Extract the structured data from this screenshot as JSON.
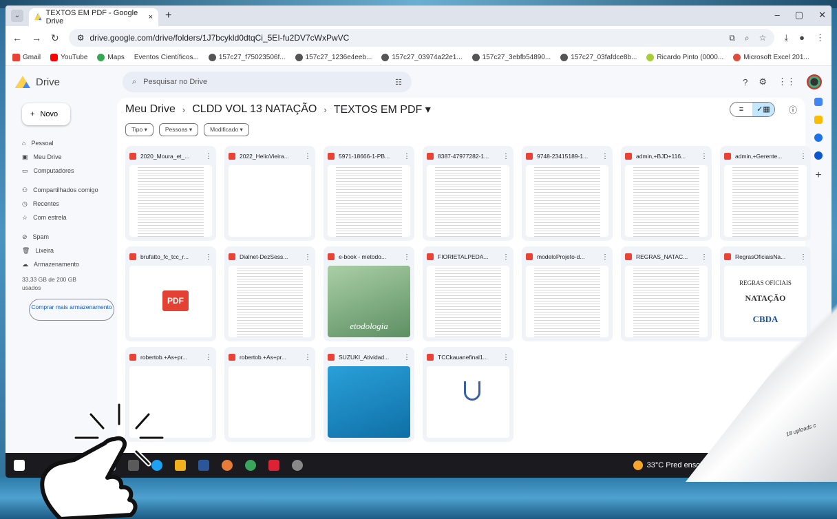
{
  "browser": {
    "tab_title": "TEXTOS EM PDF - Google Drive",
    "tab_close": "×",
    "new_tab": "+",
    "url": "drive.google.com/drive/folders/1J7bcykld0dtqCi_5EI-fu2DV7cWxPwVC",
    "bookmarks": [
      "Gmail",
      "YouTube",
      "Maps",
      "Eventos Científicos...",
      "157c27_f75023506f...",
      "157c27_1236e4eeb...",
      "157c27_03974a22e1...",
      "157c27_3ebfb54890...",
      "157c27_03fafdce8b...",
      "Ricardo Pinto (0000...",
      "Microsoft Excel 201..."
    ]
  },
  "drive": {
    "logo": "Drive",
    "search_placeholder": "Pesquisar no Drive",
    "new_label": "Novo",
    "nav": [
      "Pessoal",
      "Meu Drive",
      "Computadores",
      "Compartilhados comigo",
      "Recentes",
      "Com estrela",
      "Spam",
      "Lixeira",
      "Armazenamento"
    ],
    "storage": "33,33 GB de 200 GB usados",
    "buy_label": "Comprar mais armazenamento",
    "breadcrumb": [
      "Meu Drive",
      "CLDD VOL 13 NATAÇÃO",
      "TEXTOS EM PDF ▾"
    ],
    "filters": [
      "Tipo ▾",
      "Pessoas ▾",
      "Modificado ▾"
    ],
    "files": [
      "2020_Moura_et_...",
      "2022_HelioVieira...",
      "5971-18666-1-PB...",
      "8387-47977282-1...",
      "9748-23415189-1...",
      "admin,+BJD+116...",
      "admin,+Gerente...",
      "brufatto_fc_tcc_r...",
      "Dialnet-DezSess...",
      "e-book - metodo...",
      "FIORIETALPEDA...",
      "modeloProjeto-d...",
      "REGRAS_NATAC...",
      "RegrasOficiaisNa...",
      "robertob.+As+pr...",
      "robertob.+As+pr...",
      "SUZUKI_Atividad...",
      "TCCkauanefinal1..."
    ],
    "thumb_pdf_label": "PDF",
    "thumb_metodo_text": "etodologia",
    "thumb_regras_line1": "REGRAS OFICIAIS",
    "thumb_regras_line2": "NATAÇÃO",
    "thumb_regras_logo": "CBDA"
  },
  "taskbar": {
    "weather": "33°C  Pred ensolarado"
  },
  "curl_text": "18 uploads c"
}
